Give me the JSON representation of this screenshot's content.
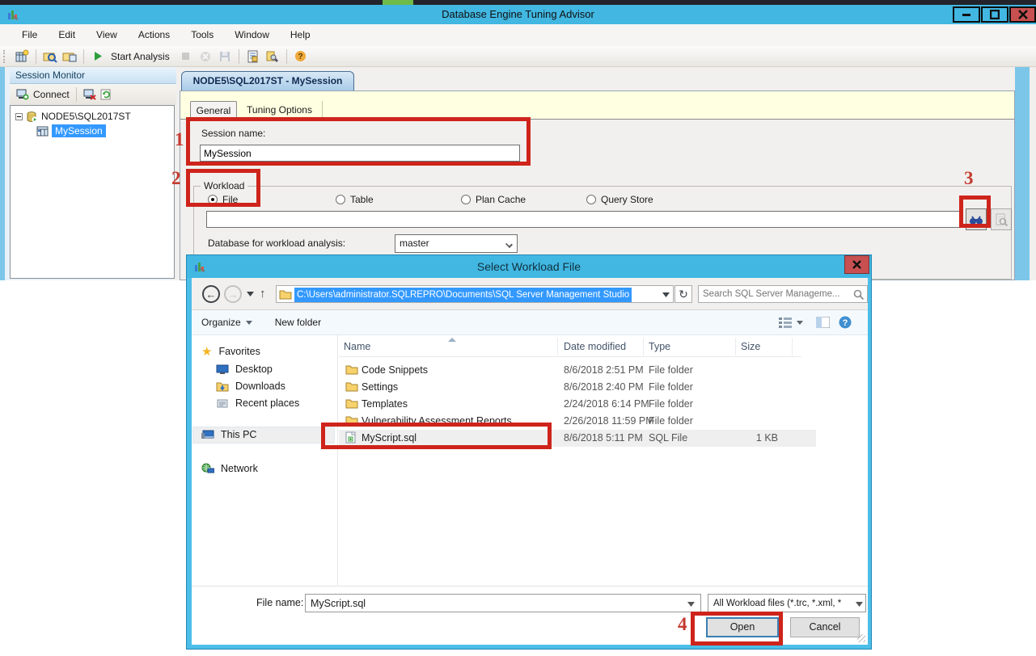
{
  "app": {
    "title": "Database Engine Tuning Advisor",
    "menu": [
      "File",
      "Edit",
      "View",
      "Actions",
      "Tools",
      "Window",
      "Help"
    ],
    "toolbar": {
      "start_analysis_label": "Start Analysis"
    },
    "session_monitor": {
      "title": "Session Monitor",
      "connect_label": "Connect",
      "tree": {
        "server": "NODE5\\SQL2017ST",
        "session": "MySession"
      }
    },
    "document_tab": "NODE5\\SQL2017ST - MySession",
    "tabs": {
      "general": "General",
      "tuning_options": "Tuning Options"
    },
    "general": {
      "session_name_label": "Session name:",
      "session_name_value": "MySession",
      "workload_group_label": "Workload",
      "radios": [
        "File",
        "Table",
        "Plan Cache",
        "Query Store"
      ],
      "selected_radio": "File",
      "workload_file_value": "",
      "database_label": "Database for workload analysis:",
      "database_value": "master"
    }
  },
  "dialog": {
    "title": "Select Workload File",
    "address": "C:\\Users\\administrator.SQLREPRO\\Documents\\SQL Server Management Studio",
    "search_placeholder": "Search SQL Server Manageme...",
    "command_bar": {
      "organize": "Organize",
      "new_folder": "New folder"
    },
    "sidebar": [
      {
        "label": "Favorites"
      },
      {
        "label": "Desktop"
      },
      {
        "label": "Downloads"
      },
      {
        "label": "Recent places"
      },
      {
        "label": "This PC"
      },
      {
        "label": "Network"
      }
    ],
    "columns": [
      "Name",
      "Date modified",
      "Type",
      "Size"
    ],
    "files": [
      {
        "name": "Code Snippets",
        "date": "8/6/2018 2:51 PM",
        "type": "File folder",
        "size": ""
      },
      {
        "name": "Settings",
        "date": "8/6/2018 2:40 PM",
        "type": "File folder",
        "size": ""
      },
      {
        "name": "Templates",
        "date": "2/24/2018 6:14 PM",
        "type": "File folder",
        "size": ""
      },
      {
        "name": "Vulnerability Assessment Reports",
        "date": "2/26/2018 11:59 PM",
        "type": "File folder",
        "size": ""
      },
      {
        "name": "MyScript.sql",
        "date": "8/6/2018 5:11 PM",
        "type": "SQL File",
        "size": "1 KB"
      }
    ],
    "footer": {
      "file_name_label": "File name:",
      "file_name_value": "MyScript.sql",
      "file_type_value": "All Workload files (*.trc, *.xml, *",
      "open_label": "Open",
      "cancel_label": "Cancel"
    }
  },
  "annotations": {
    "n1": "1",
    "n2": "2",
    "n3": "3",
    "n4": "4"
  },
  "colors": {
    "titlebar_blue": "#41B7E2",
    "close_red": "#C85050",
    "annotation_red": "#CE241B",
    "selection_blue": "#3399FF"
  }
}
